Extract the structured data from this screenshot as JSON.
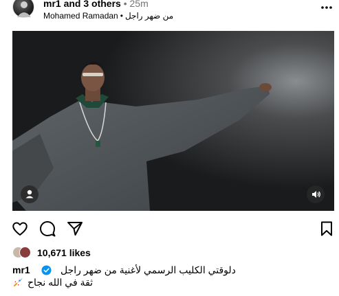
{
  "header": {
    "username": "mr1",
    "collaborators": "and 3 others",
    "separator": "•",
    "time": "25m",
    "audio_artist": "Mohamed Ramadan",
    "audio_separator": "•",
    "audio_title": "من ضهر راجل",
    "more_icon": "more-options-icon"
  },
  "media": {
    "tag_icon": "user-tag-icon",
    "sound_icon": "speaker-icon"
  },
  "actions": {
    "like_icon": "heart-icon",
    "comment_icon": "comment-icon",
    "share_icon": "send-icon",
    "save_icon": "bookmark-icon"
  },
  "likes": {
    "count_text": "10,671 likes"
  },
  "caption": {
    "username": "mr1",
    "verified_icon": "verified-badge-icon",
    "line1": "دلوقتي الكليب الرسمي لأغنية من ضهر راجل",
    "line2": "ثقة في الله نجاح",
    "line2_icon": "rocket-icon"
  },
  "colors": {
    "text": "#000000",
    "muted": "#737373",
    "verified": "#0095f6",
    "media_bg": "#1a1b1c"
  }
}
